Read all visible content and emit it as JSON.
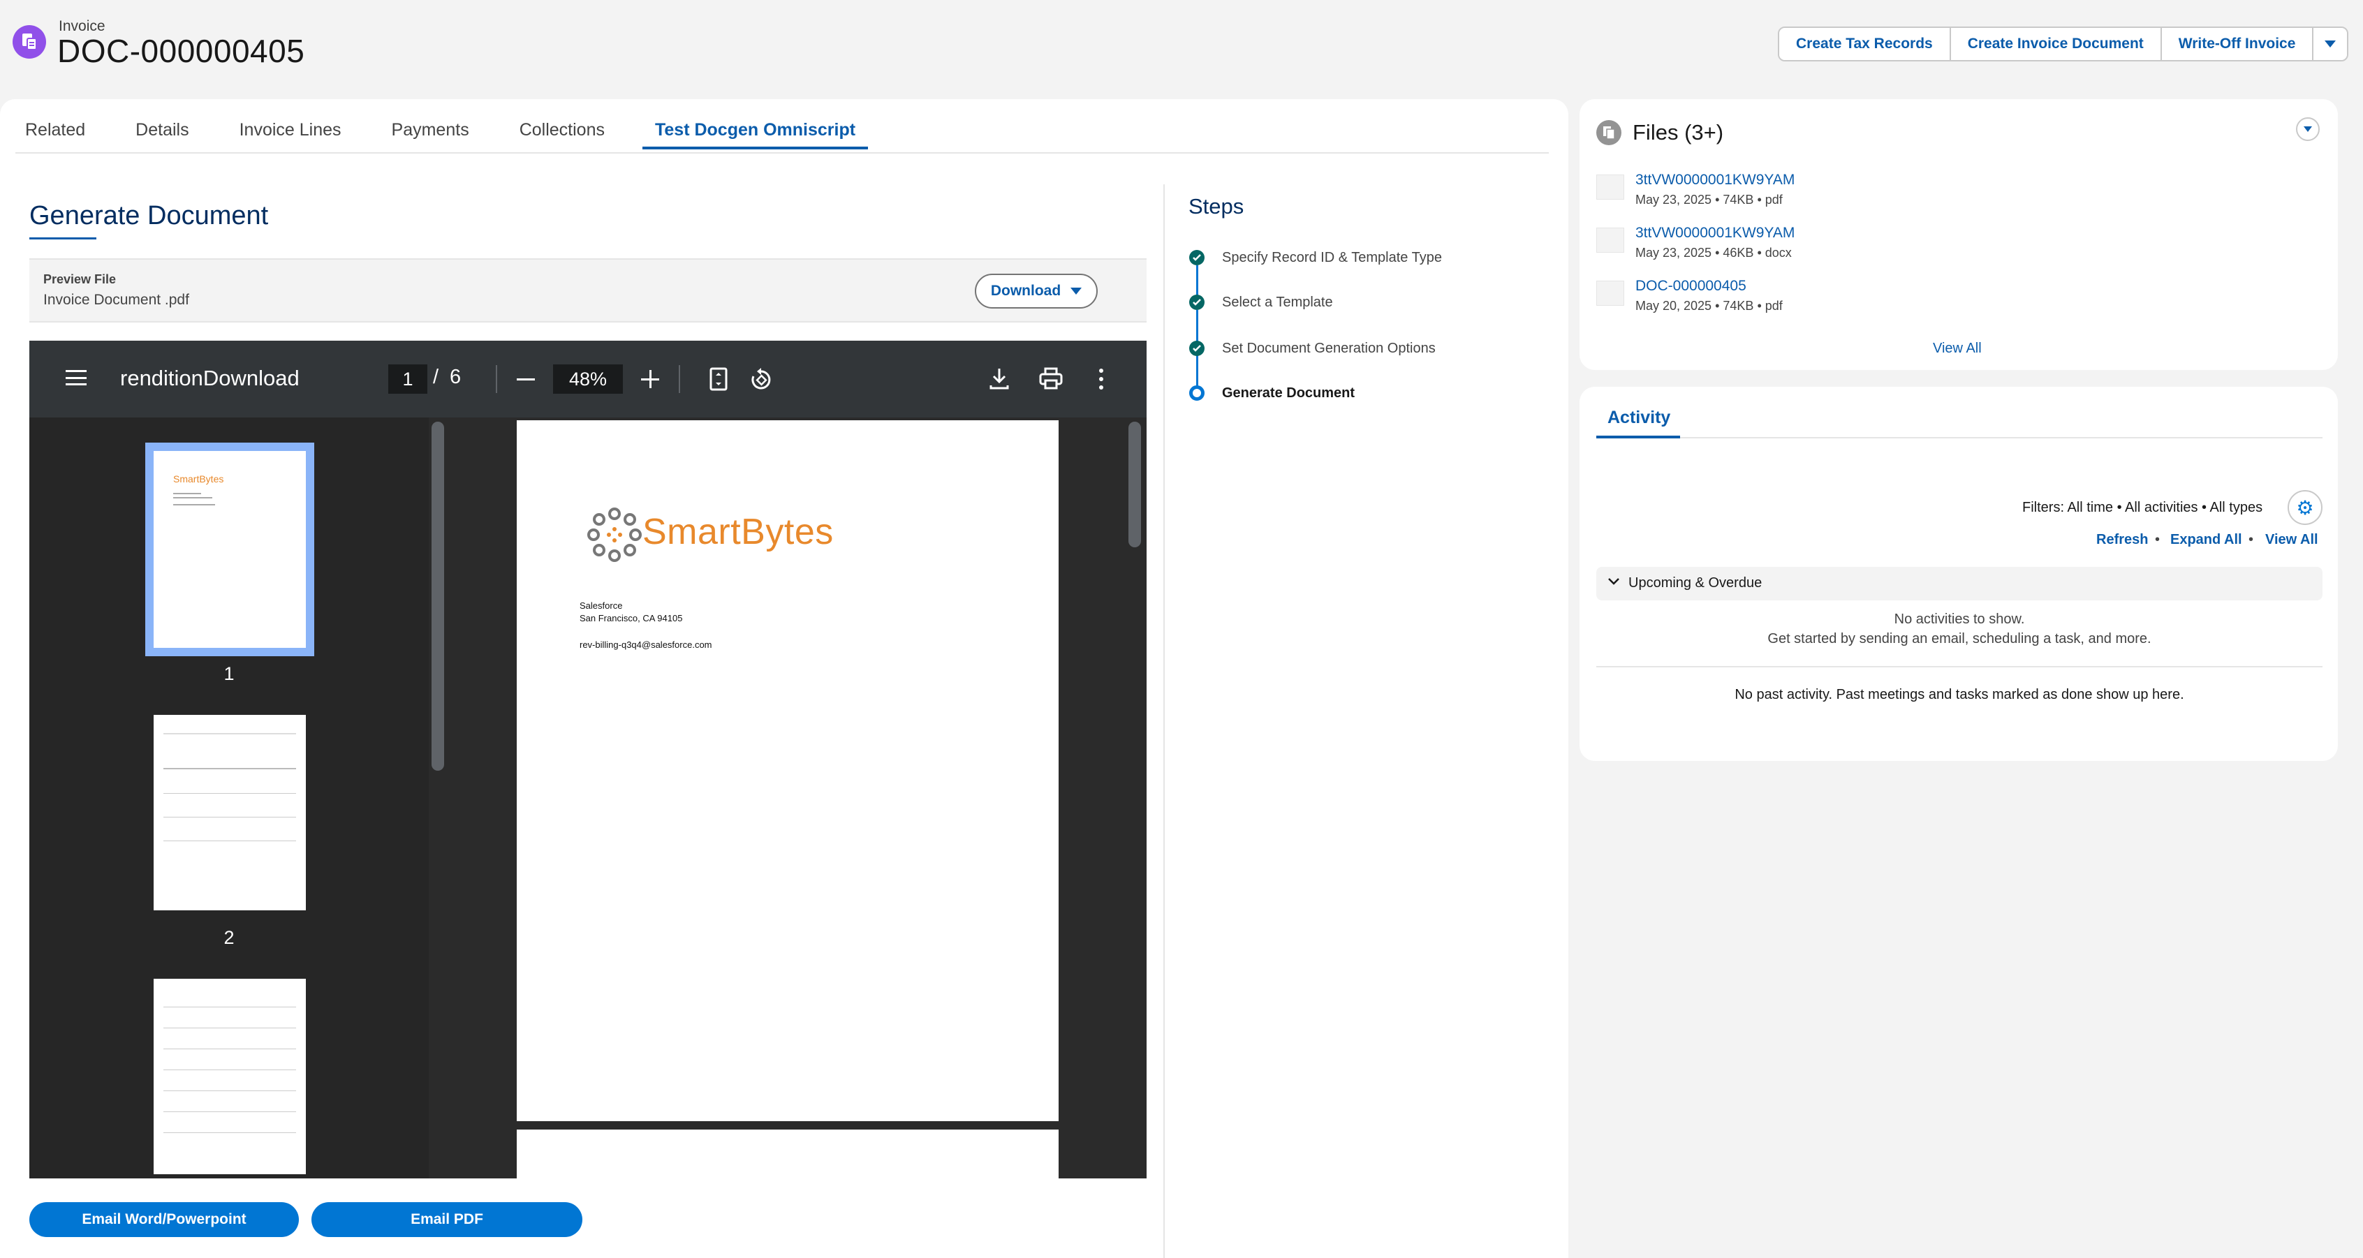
{
  "header": {
    "object_type": "Invoice",
    "record_title": "DOC-000000405",
    "actions": [
      "Create Tax Records",
      "Create Invoice Document",
      "Write-Off Invoice"
    ]
  },
  "tabs": [
    "Related",
    "Details",
    "Invoice Lines",
    "Payments",
    "Collections",
    "Test Docgen Omniscript"
  ],
  "active_tab": "Test Docgen Omniscript",
  "generate": {
    "title": "Generate Document",
    "preview_label": "Preview File",
    "preview_file": "Invoice Document .pdf",
    "download_label": "Download",
    "email_word_label": "Email Word/Powerpoint",
    "email_pdf_label": "Email PDF"
  },
  "pdf_viewer": {
    "doc_title": "renditionDownload",
    "current_page": "1",
    "page_separator": "/",
    "total_pages": "6",
    "zoom": "48%",
    "thumb_1_label": "1",
    "thumb_2_label": "2",
    "logo_text": "SmartBytes",
    "address_line1": "Salesforce",
    "address_line2": "San Francisco, CA  94105",
    "email": "rev-billing-q3q4@salesforce.com"
  },
  "steps": {
    "title": "Steps",
    "items": [
      {
        "label": "Specify Record ID & Template Type",
        "status": "complete"
      },
      {
        "label": "Select a Template",
        "status": "complete"
      },
      {
        "label": "Set Document Generation Options",
        "status": "complete"
      },
      {
        "label": "Generate Document",
        "status": "current"
      }
    ]
  },
  "files": {
    "title": "Files (3+)",
    "items": [
      {
        "name": "3ttVW0000001KW9YAM",
        "date": "May 23, 2025",
        "size": "74KB",
        "ext": "pdf"
      },
      {
        "name": "3ttVW0000001KW9YAM",
        "date": "May 23, 2025",
        "size": "46KB",
        "ext": "docx"
      },
      {
        "name": "DOC-000000405",
        "date": "May 20, 2025",
        "size": "74KB",
        "ext": "pdf"
      }
    ],
    "view_all": "View All"
  },
  "activity": {
    "tab": "Activity",
    "filters": "Filters: All time • All activities • All types",
    "refresh": "Refresh",
    "expand_all": "Expand All",
    "view_all": "View All",
    "upcoming": "Upcoming & Overdue",
    "no_activities": "No activities to show.",
    "get_started": "Get started by sending an email, scheduling a task, and more.",
    "no_past": "No past activity. Past meetings and tasks marked as done show up here."
  },
  "colors": {
    "brand_blue": "#0176d3",
    "link_blue": "#0b5cab",
    "step_complete": "#056764",
    "invoice_icon": "#9050e9",
    "logo_orange": "#e8892c"
  }
}
